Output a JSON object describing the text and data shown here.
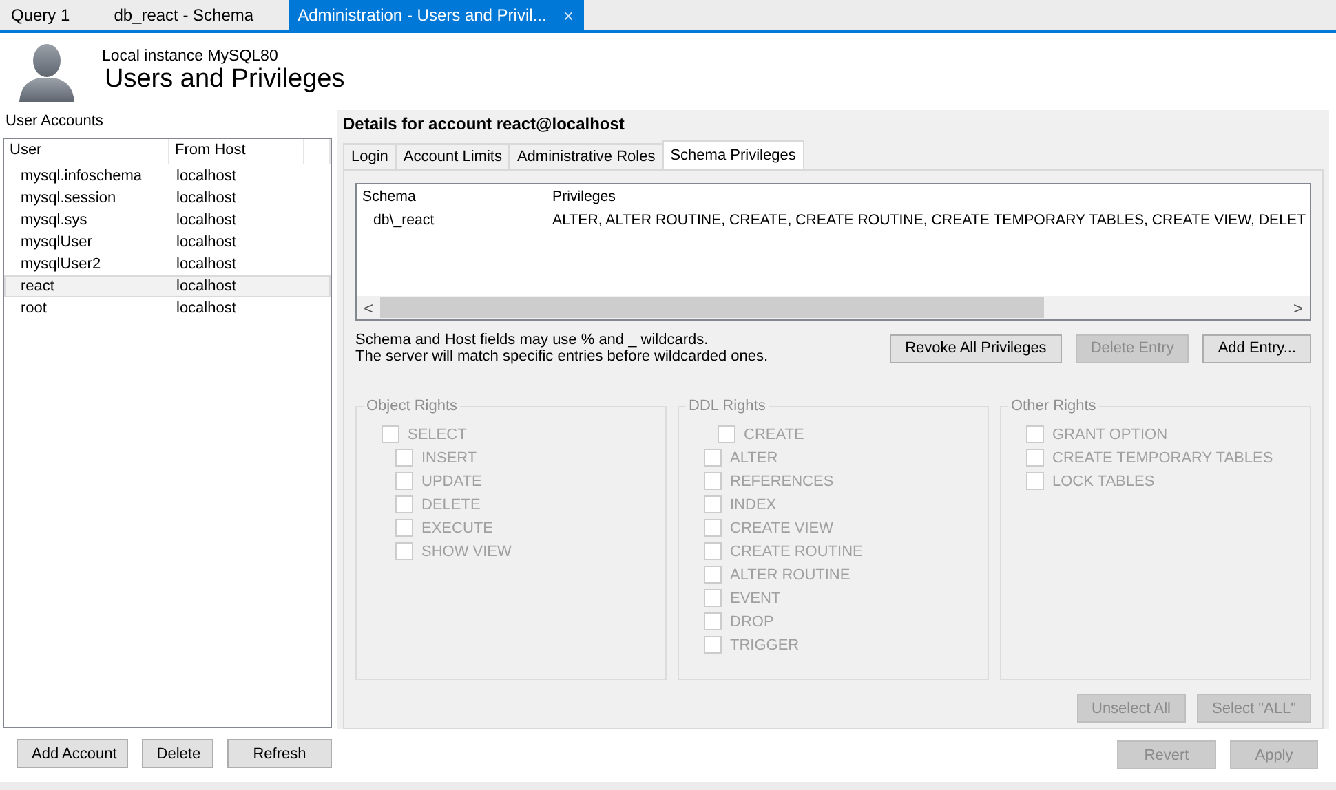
{
  "doc_tabs": [
    {
      "label": "Query 1",
      "selected": false
    },
    {
      "label": "db_react - Schema",
      "selected": false
    },
    {
      "label": "Administration - Users and Privil...",
      "selected": true,
      "close": "×"
    }
  ],
  "header": {
    "subtitle": "Local instance MySQL80",
    "title": "Users and Privileges"
  },
  "accounts": {
    "label": "User Accounts",
    "columns": [
      "User",
      "From Host"
    ],
    "rows": [
      {
        "user": "mysql.infoschema",
        "host": "localhost",
        "selected": false
      },
      {
        "user": "mysql.session",
        "host": "localhost",
        "selected": false
      },
      {
        "user": "mysql.sys",
        "host": "localhost",
        "selected": false
      },
      {
        "user": "mysqlUser",
        "host": "localhost",
        "selected": false
      },
      {
        "user": "mysqlUser2",
        "host": "localhost",
        "selected": false
      },
      {
        "user": "react",
        "host": "localhost",
        "selected": true
      },
      {
        "user": "root",
        "host": "localhost",
        "selected": false
      }
    ],
    "buttons": [
      "Add Account",
      "Delete",
      "Refresh"
    ]
  },
  "details": {
    "title": "Details for account react@localhost",
    "tabs": [
      {
        "label": "Login",
        "selected": false
      },
      {
        "label": "Account Limits",
        "selected": false
      },
      {
        "label": "Administrative Roles",
        "selected": false
      },
      {
        "label": "Schema Privileges",
        "selected": true
      }
    ],
    "table": {
      "columns": [
        "Schema",
        "Privileges"
      ],
      "rows": [
        {
          "schema": "db\\_react",
          "privileges": "ALTER, ALTER ROUTINE, CREATE, CREATE ROUTINE, CREATE TEMPORARY TABLES, CREATE VIEW, DELET"
        }
      ],
      "scroll_left": "<",
      "scroll_right": ">"
    },
    "hint": [
      "Schema and Host fields may use % and _ wildcards.",
      "The server will match specific entries before wildcarded ones."
    ],
    "entry_buttons": [
      {
        "label": "Revoke All Privileges",
        "disabled": false
      },
      {
        "label": "Delete Entry",
        "disabled": true
      },
      {
        "label": "Add Entry...",
        "disabled": false
      }
    ],
    "groups": [
      {
        "title": "Object Rights",
        "items": [
          {
            "label": "SELECT",
            "checked": false,
            "disabled": true,
            "kind": "plain",
            "children": [
              {
                "label": "INSERT",
                "checked": false,
                "disabled": true,
                "kind": "plain"
              },
              {
                "label": "UPDATE",
                "checked": false,
                "disabled": true,
                "kind": "plain"
              },
              {
                "label": "DELETE",
                "checked": false,
                "disabled": true,
                "kind": "plain"
              },
              {
                "label": "EXECUTE",
                "checked": false,
                "disabled": true,
                "kind": "plain"
              },
              {
                "label": "SHOW VIEW",
                "checked": false,
                "disabled": true,
                "kind": "plain"
              }
            ]
          }
        ]
      },
      {
        "title": "DDL Rights",
        "items": [
          {
            "label": "CREATE",
            "checked": false,
            "disabled": true,
            "kind": "offset"
          },
          {
            "label": "ALTER",
            "checked": false,
            "disabled": true,
            "kind": "plain"
          },
          {
            "label": "REFERENCES",
            "checked": false,
            "disabled": true,
            "kind": "plain"
          },
          {
            "label": "INDEX",
            "checked": false,
            "disabled": true,
            "kind": "plain"
          },
          {
            "label": "CREATE VIEW",
            "checked": false,
            "disabled": true,
            "kind": "plain"
          },
          {
            "label": "CREATE ROUTINE",
            "checked": false,
            "disabled": true,
            "kind": "plain"
          },
          {
            "label": "ALTER ROUTINE",
            "checked": false,
            "disabled": true,
            "kind": "plain"
          },
          {
            "label": "EVENT",
            "checked": false,
            "disabled": true,
            "kind": "plain"
          },
          {
            "label": "DROP",
            "checked": false,
            "disabled": true,
            "kind": "plain"
          },
          {
            "label": "TRIGGER",
            "checked": false,
            "disabled": true,
            "kind": "plain"
          }
        ]
      },
      {
        "title": "Other Rights",
        "items": [
          {
            "label": "GRANT OPTION",
            "checked": false,
            "disabled": true,
            "kind": "plain"
          },
          {
            "label": "CREATE TEMPORARY TABLES",
            "checked": false,
            "disabled": true,
            "kind": "plain"
          },
          {
            "label": "LOCK TABLES",
            "checked": false,
            "disabled": true,
            "kind": "plain"
          }
        ]
      }
    ],
    "select_buttons": [
      {
        "label": "Unselect All",
        "disabled": true
      },
      {
        "label": "Select \"ALL\"",
        "disabled": true
      }
    ],
    "footer_buttons": [
      {
        "label": "Revert",
        "disabled": true
      },
      {
        "label": "Apply",
        "disabled": true
      }
    ]
  }
}
